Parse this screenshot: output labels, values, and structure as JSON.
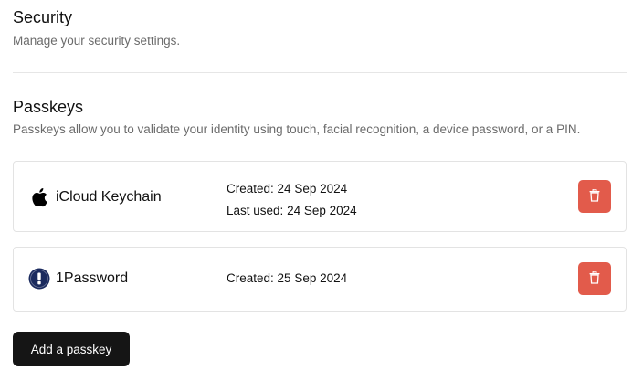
{
  "security": {
    "title": "Security",
    "subtitle": "Manage your security settings."
  },
  "passkeys": {
    "title": "Passkeys",
    "subtitle": "Passkeys allow you to validate your identity using touch, facial recognition, a device password, or a PIN.",
    "items": [
      {
        "name": "iCloud Keychain",
        "icon": "apple-icon",
        "created_label": "Created:",
        "created": "24 Sep 2024",
        "last_used_label": "Last used:",
        "last_used": "24 Sep 2024"
      },
      {
        "name": "1Password",
        "icon": "1password-icon",
        "created_label": "Created:",
        "created": "25 Sep 2024"
      }
    ],
    "add_button": "Add a passkey"
  },
  "colors": {
    "delete": "#e25b4b",
    "primary_button": "#151515",
    "onepassword_badge": "#1a2a5e"
  }
}
